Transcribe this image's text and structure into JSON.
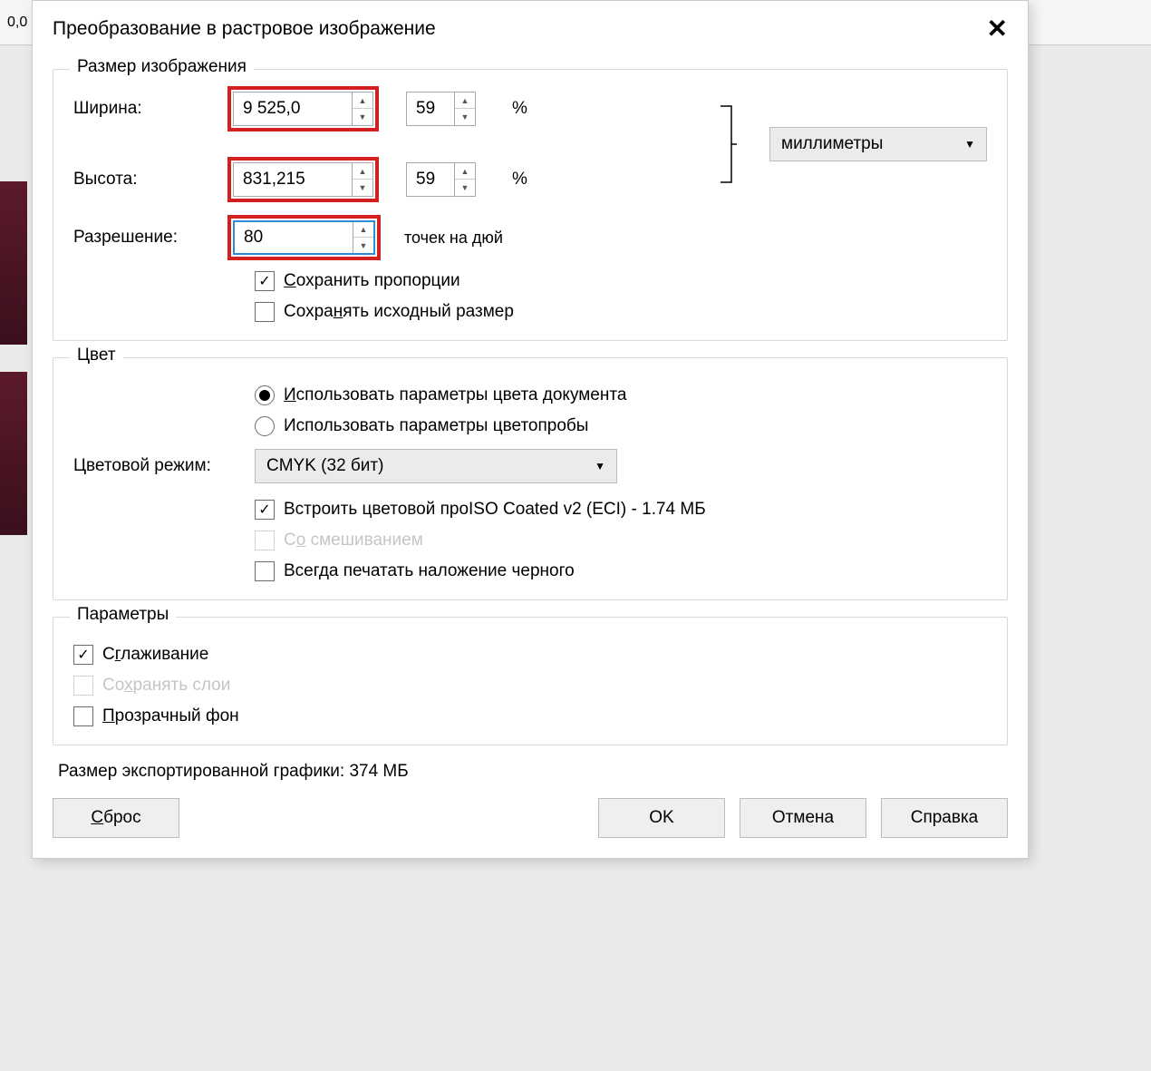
{
  "toolbar_fragment": "0,0",
  "dialog": {
    "title": "Преобразование в растровое изображение"
  },
  "size": {
    "legend": "Размер изображения",
    "width_label": "Ширина:",
    "width_value": "9 525,0",
    "width_pct": "59",
    "height_label": "Высота:",
    "height_value": "831,215",
    "height_pct": "59",
    "pct_symbol": "%",
    "resolution_label": "Разрешение:",
    "resolution_value": "80",
    "resolution_unit": "точек на дюй",
    "units_label": "миллиметры",
    "keep_aspect": "Сохранить пропорции",
    "keep_original": "Сохранять исходный размер"
  },
  "color": {
    "legend": "Цвет",
    "use_doc": "Использовать параметры цвета документа",
    "use_proof": "Использовать параметры цветопробы",
    "mode_label": "Цветовой режим:",
    "mode_value": "CMYK (32 бит)",
    "embed_profile": "Встроить цветовой про",
    "profile_info": "ISO Coated v2 (ECI) - 1.74 МБ",
    "dither": "Со смешиванием",
    "overprint_black": "Всегда печатать наложение черного"
  },
  "options": {
    "legend": "Параметры",
    "antialias": "Сглаживание",
    "keep_layers": "Сохранять слои",
    "transparent_bg": "Прозрачный фон"
  },
  "status": "Размер экспортированной графики: 374 МБ",
  "buttons": {
    "reset": "Сброс",
    "ok": "OK",
    "cancel": "Отмена",
    "help": "Справка"
  }
}
